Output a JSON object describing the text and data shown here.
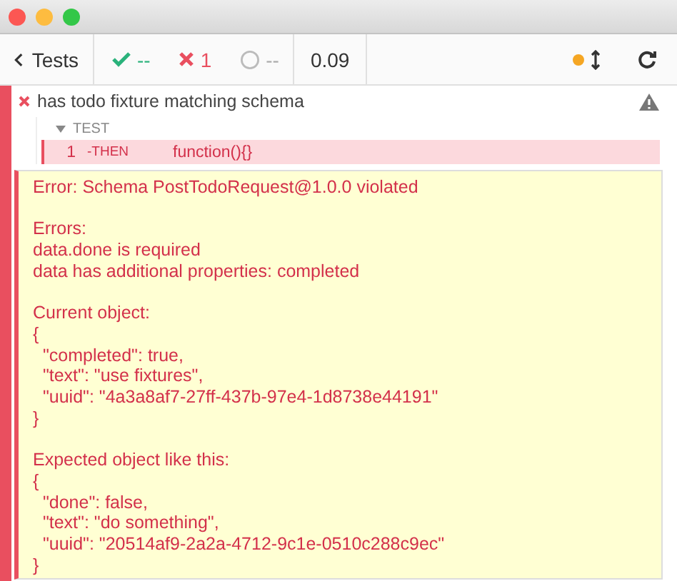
{
  "toolbar": {
    "back_label": "Tests",
    "passed": "--",
    "failed": "1",
    "pending": "--",
    "duration": "0.09"
  },
  "test": {
    "failed": true,
    "title": "has todo fixture matching schema",
    "section": {
      "label": "TEST",
      "expanded": true
    },
    "commands": [
      {
        "number": "1",
        "name": "-THEN",
        "message": "function(){}",
        "failed": true
      }
    ],
    "error_paragraphs": [
      [
        "Error: Schema PostTodoRequest@1.0.0 violated"
      ],
      [
        "Errors:",
        "data.done is required",
        "data has additional properties: completed"
      ],
      [
        "Current object:",
        "{",
        "  \"completed\": true,",
        "  \"text\": \"use fixtures\",",
        "  \"uuid\": \"4a3a8af7-27ff-437b-97e4-1d8738e44191\"",
        "}"
      ],
      [
        "Expected object like this:",
        "{",
        "  \"done\": false,",
        "  \"text\": \"do something\",",
        "  \"uuid\": \"20514af9-2a2a-4712-9c1e-0510c288c9ec\"",
        "}"
      ]
    ]
  }
}
